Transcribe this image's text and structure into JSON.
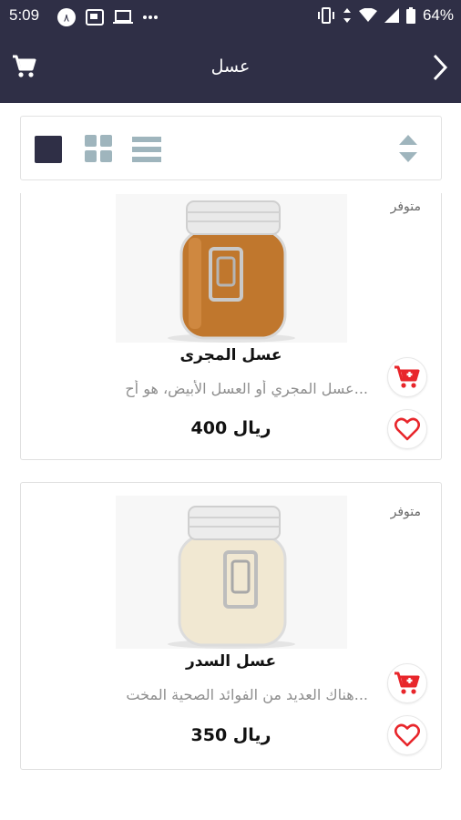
{
  "status_bar": {
    "time": "5:09",
    "battery": "64%"
  },
  "app_bar": {
    "title": "عسل"
  },
  "products": [
    {
      "availability": "متوفر",
      "name": "عسل المجرى",
      "description": "عسل المجري أو العسل الأبيض، هو أح...",
      "price": "400 ريال",
      "jar_color": "#c0772d"
    },
    {
      "availability": "متوفر",
      "name": "عسل السدر",
      "description": "هناك العديد من الفوائد الصحية المخت...",
      "price": "350 ريال",
      "jar_color": "#f1e8d2"
    }
  ],
  "colors": {
    "header_bg": "#2f2f46",
    "accent_red": "#e8262b",
    "view_selected": "#2f2f46",
    "view_unselected": "#9fb5bd"
  }
}
